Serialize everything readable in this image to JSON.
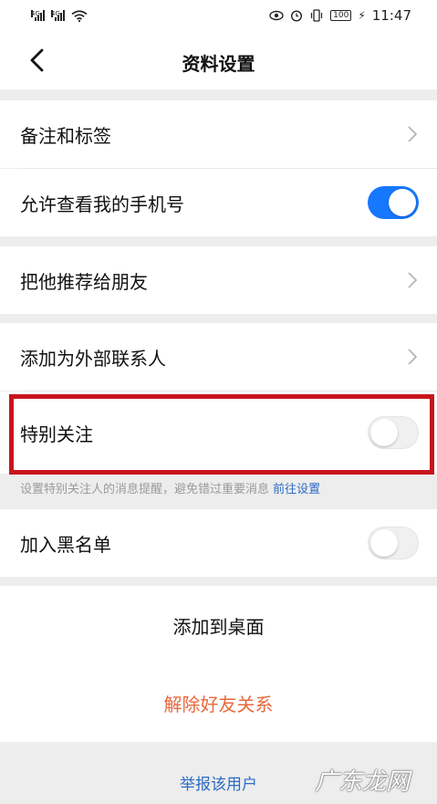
{
  "status_bar": {
    "signal_1_label": "4G",
    "signal_2_label": "4G",
    "battery": "100",
    "time": "11:47"
  },
  "header": {
    "title": "资料设置",
    "back_icon": "chevron-left-icon"
  },
  "rows": {
    "remark_tags": "备注和标签",
    "allow_view_phone": "允许查看我的手机号",
    "recommend_friend": "把他推荐给朋友",
    "add_external_contact": "添加为外部联系人",
    "special_attention": "特别关注",
    "add_blacklist": "加入黑名单"
  },
  "toggles": {
    "allow_view_phone": "on",
    "special_attention": "off",
    "add_blacklist": "off"
  },
  "hint": {
    "text": "设置特别关注人的消息提醒，避免错过重要消息",
    "link": "前往设置"
  },
  "actions": {
    "add_to_desktop": "添加到桌面",
    "remove_friend": "解除好友关系",
    "report_user": "举报该用户"
  },
  "watermark": "广东龙网",
  "colors": {
    "accent_blue": "#1677ff",
    "link_blue": "#2d6bc5",
    "danger_orange": "#e8683d",
    "highlight_red": "#c8151d"
  }
}
